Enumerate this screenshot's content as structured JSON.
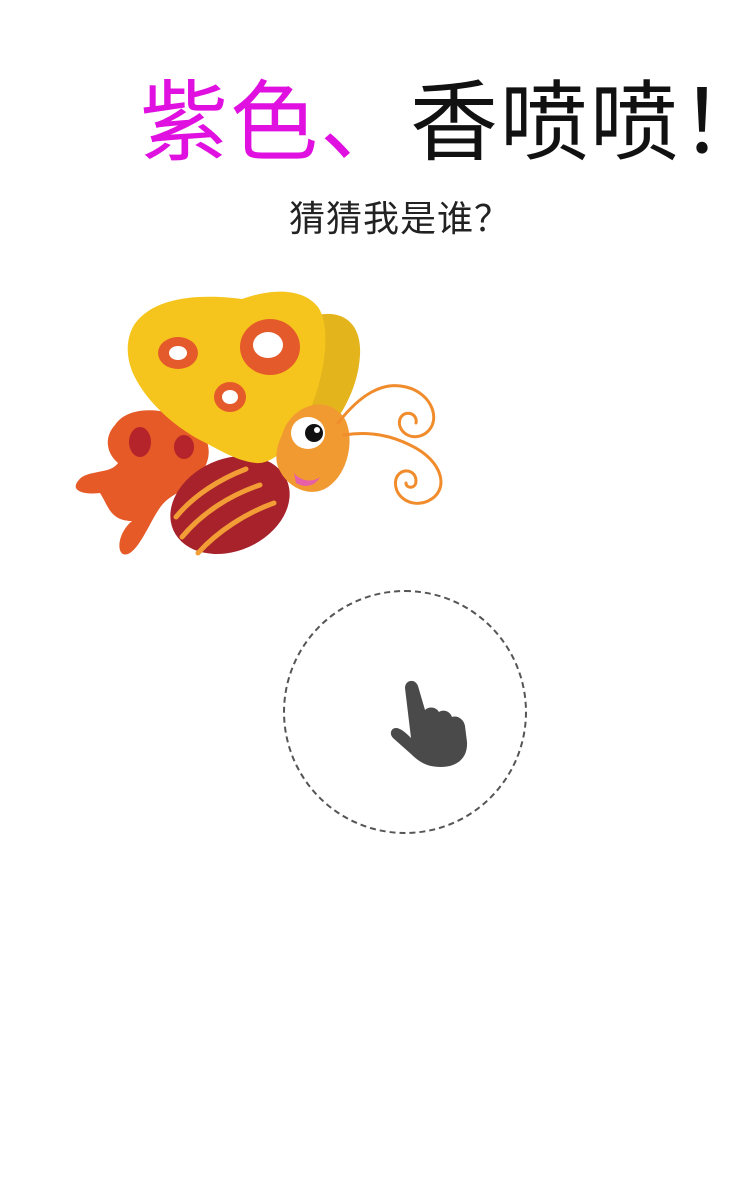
{
  "headline": {
    "part1": "紫色、",
    "part2": "香喷喷！"
  },
  "subtitle": "猜猜我是谁？",
  "colors": {
    "headline_accent": "#e010e0",
    "headline_text": "#111111",
    "subtitle_text": "#222222",
    "tap_border": "#555555",
    "hand_icon": "#4a4a4a"
  },
  "illustration": {
    "name": "butterfly-icon"
  },
  "tap_target": {
    "icon": "pointing-hand-icon"
  }
}
